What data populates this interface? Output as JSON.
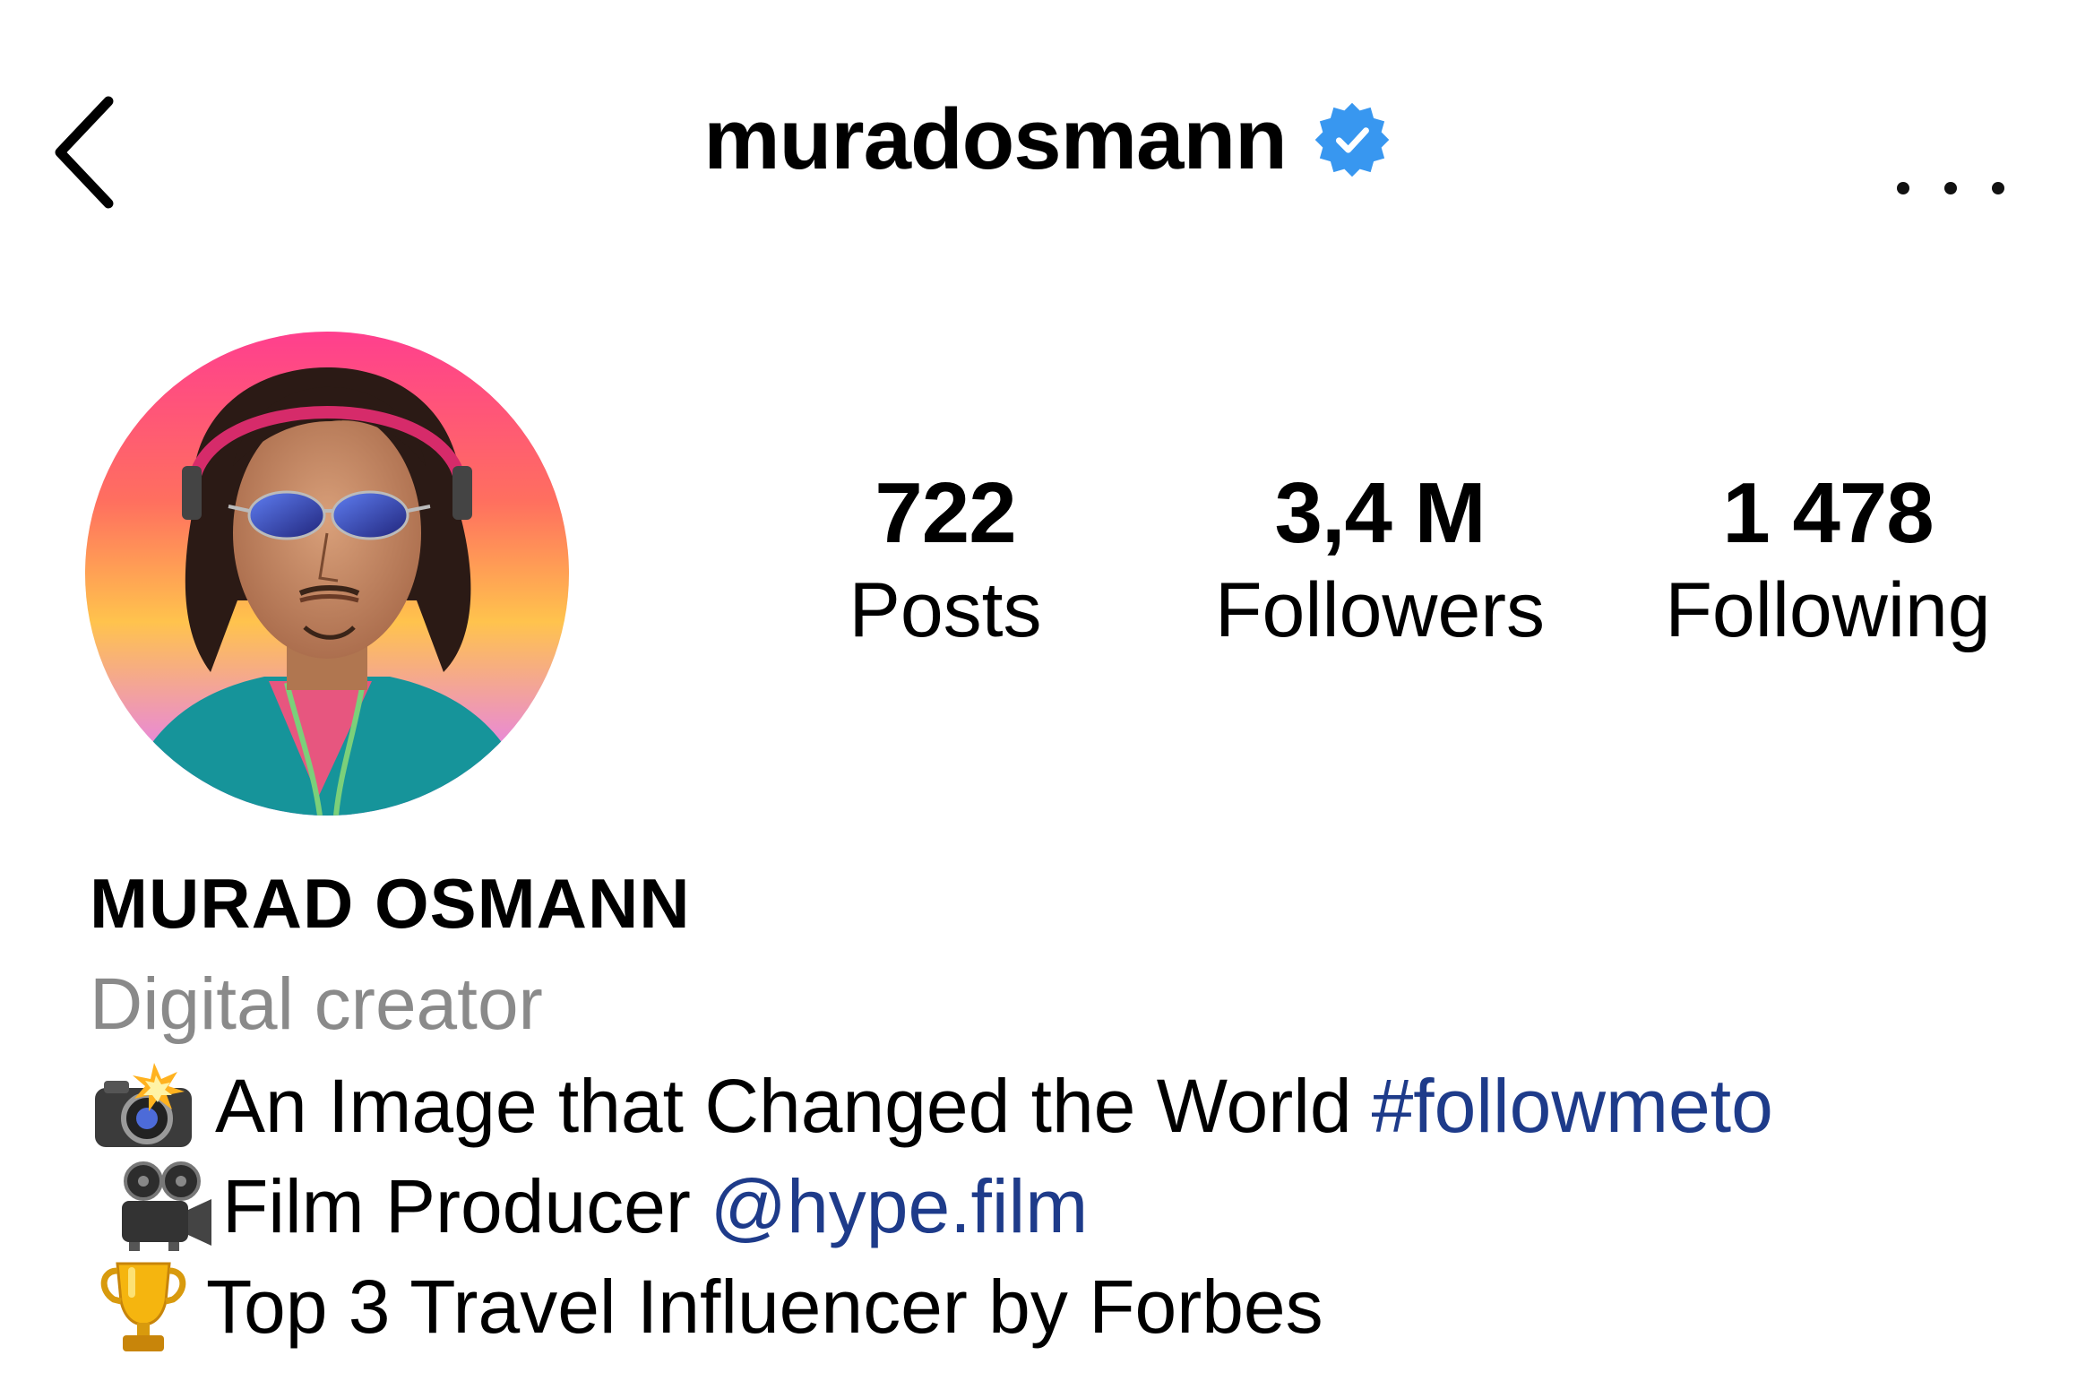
{
  "header": {
    "username": "muradosmann",
    "verified": true,
    "accent_color": "#3897f0"
  },
  "profile": {
    "avatar_icon": "profile-photo"
  },
  "stats": {
    "posts": {
      "count": "722",
      "label": "Posts"
    },
    "followers": {
      "count": "3,4 M",
      "label": "Followers"
    },
    "following": {
      "count": "1 478",
      "label": "Following"
    }
  },
  "bio": {
    "full_name": "MURAD OSMANN",
    "category": "Digital creator",
    "line1": {
      "icon": "camera-flash-icon",
      "text": "An Image that Changed the World",
      "hashtag": "#followmeto"
    },
    "line2": {
      "icon": "movie-camera-icon",
      "text": "Film Producer",
      "mention": "@hype.film"
    },
    "line3": {
      "icon": "trophy-icon",
      "text": "Top 3 Travel Influencer by Forbes"
    },
    "link_color": "#1e3b8a"
  }
}
